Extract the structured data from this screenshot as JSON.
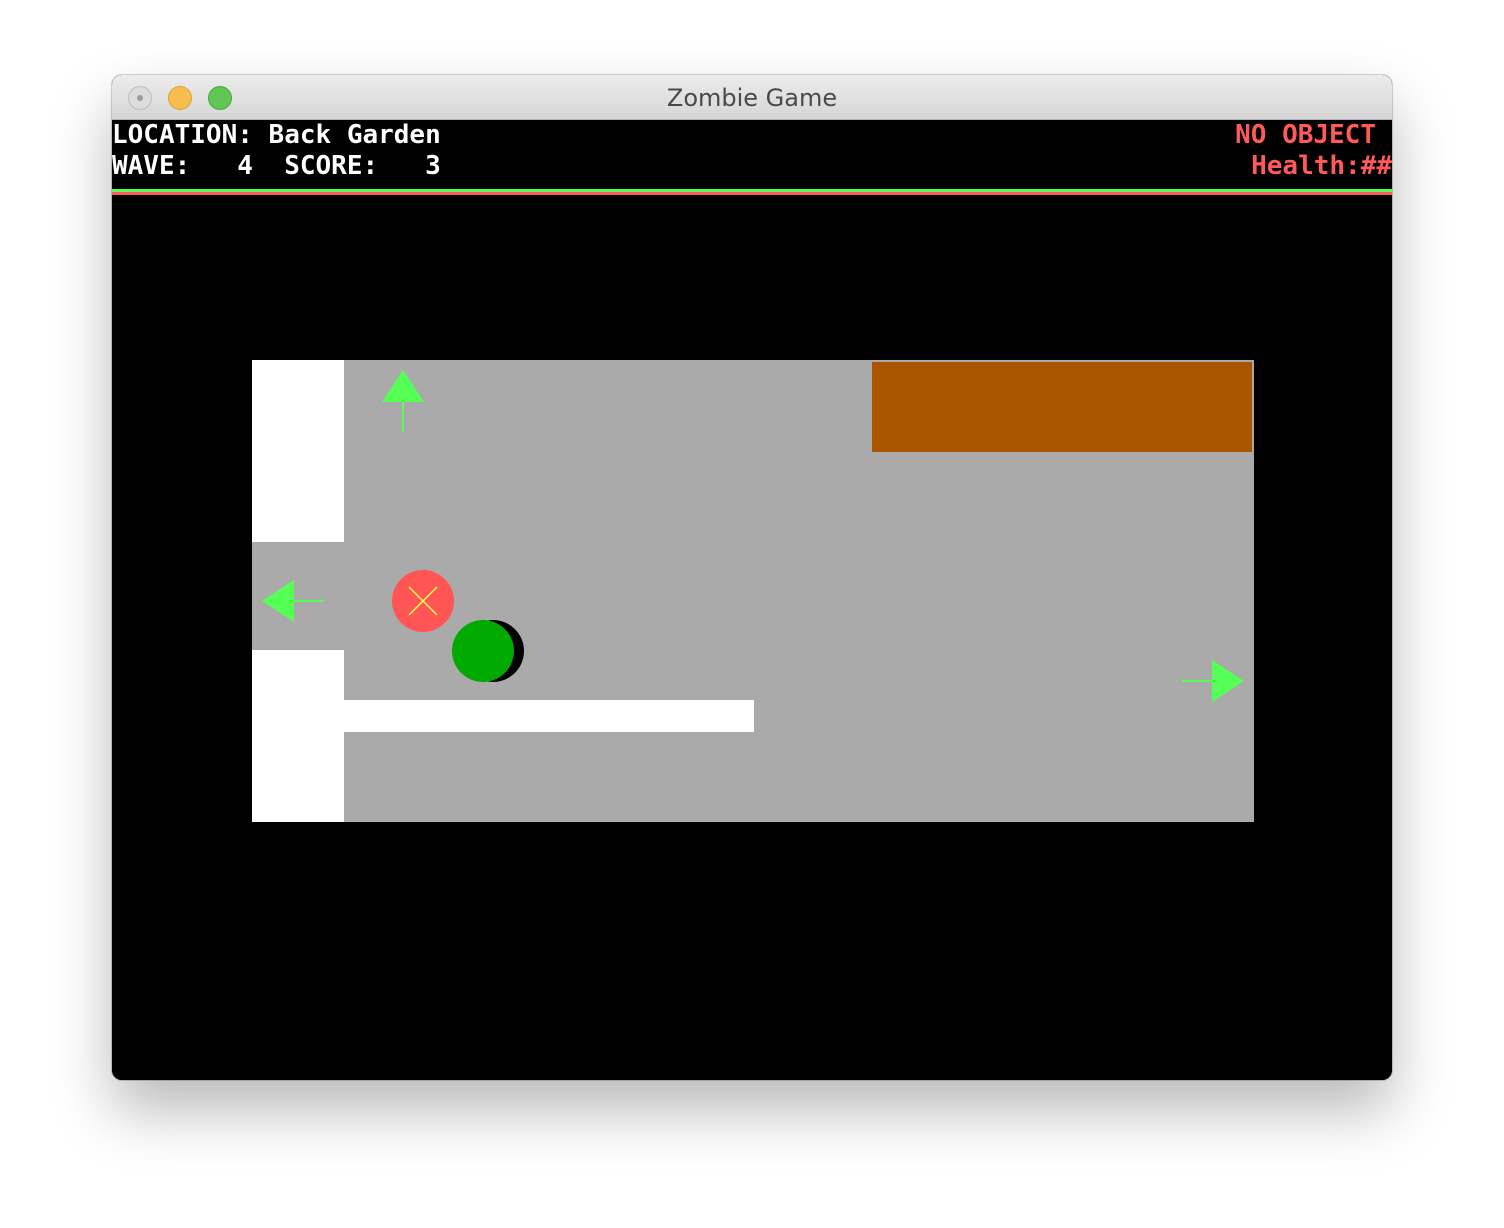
{
  "window": {
    "title": "Zombie Game",
    "buttons": [
      "close",
      "minimize",
      "maximize"
    ]
  },
  "hud": {
    "location_label": "LOCATION:",
    "location_value": "Back Garden",
    "wave_label": "WAVE:",
    "wave_value": "4",
    "score_label": "SCORE:",
    "score_value": "3",
    "object_status": "NO OBJECT",
    "health_label": "Health:",
    "health_value": "##"
  },
  "scene": {
    "exits": [
      "up",
      "left",
      "right"
    ],
    "player": "green circle",
    "target": "red circle with cross",
    "objects": [
      "white walls",
      "brown crate"
    ]
  },
  "colors": {
    "hud_text": "#ffffff",
    "hud_alert": "#ff5a5a",
    "exit_arrow": "#55ff55",
    "floor": "#aaaaaa",
    "wall": "#ffffff",
    "crate": "#aa5500",
    "player": "#00aa00",
    "target": "#ff5555",
    "target_cross": "#ffff55"
  }
}
